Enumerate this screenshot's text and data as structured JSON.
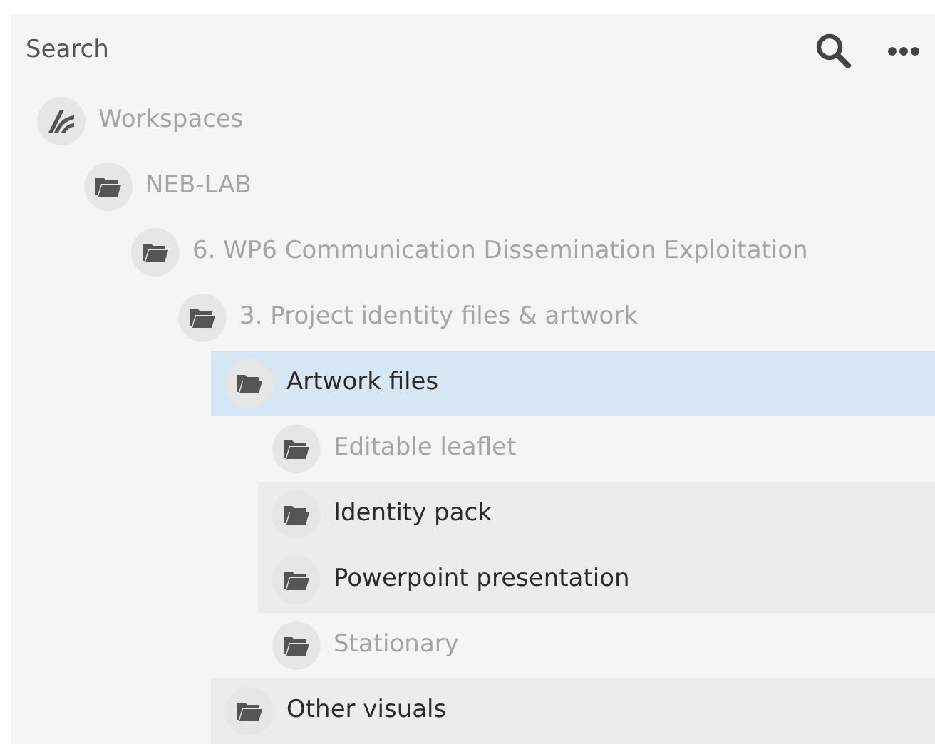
{
  "search": {
    "placeholder": "Search"
  },
  "tree": [
    {
      "label": "Workspaces",
      "kind": "workspace",
      "dimmed": true,
      "selected": false,
      "children": [
        {
          "label": "NEB-LAB",
          "kind": "folder",
          "dimmed": true,
          "selected": false,
          "children": [
            {
              "label": "6. WP6 Communication Dissemination Exploitation",
              "kind": "folder",
              "dimmed": true,
              "selected": false,
              "children": [
                {
                  "label": "3. Project identity files & artwork",
                  "kind": "folder",
                  "dimmed": true,
                  "selected": false,
                  "children": [
                    {
                      "label": "Artwork files",
                      "kind": "folder",
                      "dimmed": false,
                      "selected": true,
                      "children": [
                        {
                          "label": "Editable leaflet",
                          "kind": "folder",
                          "dimmed": true,
                          "selected": false
                        },
                        {
                          "label": "Identity pack",
                          "kind": "folder",
                          "dimmed": false,
                          "selected": false
                        },
                        {
                          "label": "Powerpoint presentation",
                          "kind": "folder",
                          "dimmed": false,
                          "selected": false
                        },
                        {
                          "label": "Stationary",
                          "kind": "folder",
                          "dimmed": true,
                          "selected": false
                        }
                      ]
                    },
                    {
                      "label": "Other visuals",
                      "kind": "folder",
                      "dimmed": false,
                      "selected": false
                    }
                  ]
                }
              ]
            }
          ]
        }
      ]
    }
  ]
}
